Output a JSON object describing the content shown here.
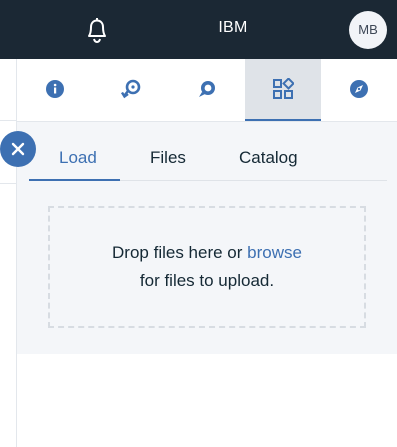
{
  "header": {
    "brand": "IBM",
    "avatar_initials": "MB",
    "bell_icon": "bell-icon"
  },
  "toolbar": {
    "icons": [
      "info-icon",
      "history-icon",
      "chat-icon",
      "data-icon",
      "compass-icon"
    ],
    "active_index": 3
  },
  "tabs": [
    {
      "label": "Load",
      "active": true
    },
    {
      "label": "Files",
      "active": false
    },
    {
      "label": "Catalog",
      "active": false
    }
  ],
  "dropzone": {
    "line1_prefix": "Drop files here or",
    "browse_link": "browse",
    "line2": "for files to upload."
  },
  "colors": {
    "header_bg": "#1b2834",
    "accent": "#3d70b2",
    "panel_bg": "#f4f6f9"
  }
}
